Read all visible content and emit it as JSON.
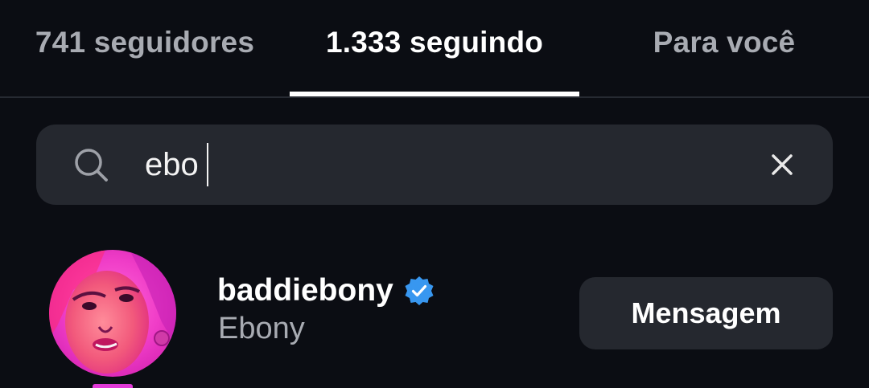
{
  "tabs": [
    {
      "label": "741 seguidores",
      "active": false
    },
    {
      "label": "1.333 seguindo",
      "active": true
    },
    {
      "label": "Para você",
      "active": false
    }
  ],
  "search": {
    "value": "ebo",
    "icon": "search-icon",
    "clear_icon": "close-icon"
  },
  "results": [
    {
      "username": "baddiebony",
      "full_name": "Ebony",
      "verified": true,
      "verified_icon": "verified-badge-icon",
      "action_label": "Mensagem"
    }
  ],
  "colors": {
    "background": "#0b0d13",
    "surface": "#25282f",
    "active_text": "#ffffff",
    "inactive_text": "#a8abb2",
    "verified_blue": "#3897f0"
  }
}
